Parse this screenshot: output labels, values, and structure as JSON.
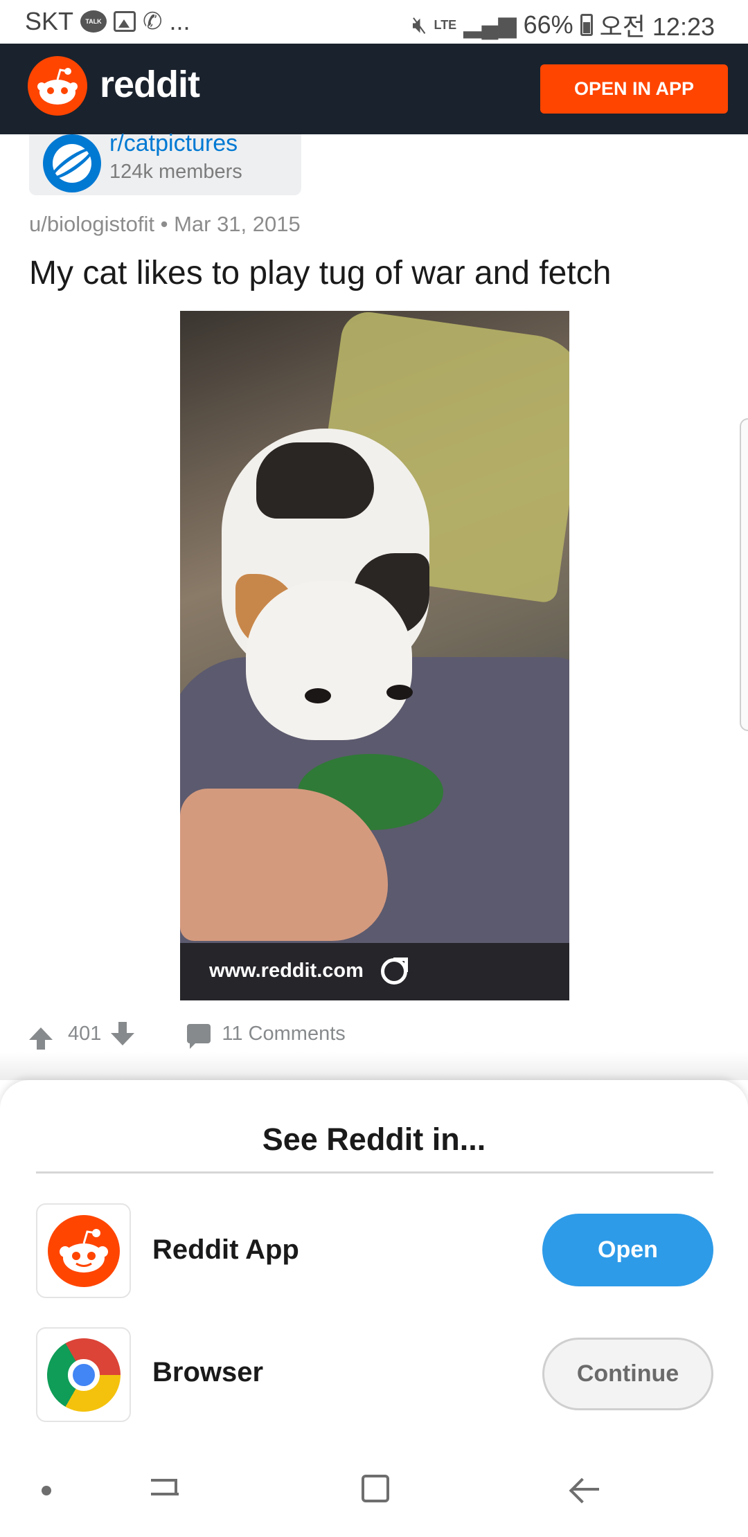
{
  "status_bar": {
    "carrier": "SKT",
    "talk_badge": "TALK",
    "ellipsis": "...",
    "network": "LTE",
    "battery": "66%",
    "time": "오전 12:23"
  },
  "header": {
    "logo_text": "reddit",
    "open_in_app_label": "OPEN IN APP"
  },
  "subreddit": {
    "name": "r/catpictures",
    "members": "124k members"
  },
  "post": {
    "author": "u/biologistofit",
    "separator": "•",
    "date": "Mar 31, 2015",
    "title": "My cat likes to play tug of war and fetch",
    "link_domain": "www.reddit.com",
    "score": "401",
    "comments_label": "11 Comments"
  },
  "sheet": {
    "title": "See Reddit in...",
    "options": [
      {
        "label": "Reddit App",
        "button": "Open",
        "icon": "reddit-logo-icon"
      },
      {
        "label": "Browser",
        "button": "Continue",
        "icon": "chrome-icon"
      }
    ]
  },
  "colors": {
    "brand": "#ff4500",
    "header_bg": "#1a222d",
    "link_blue": "#0079d3",
    "open_button": "#2e9be8"
  }
}
